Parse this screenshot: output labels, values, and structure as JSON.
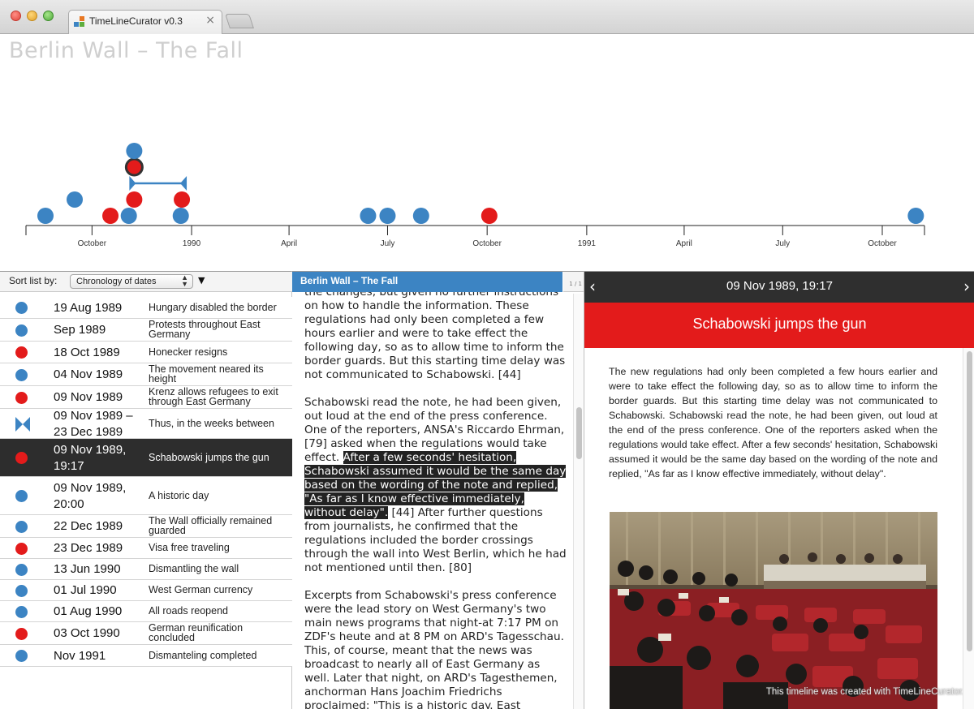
{
  "window": {
    "tab_title": "TimeLineCurator v0.3",
    "tab_close": "×"
  },
  "timeline": {
    "title": "Berlin Wall – The Fall",
    "axis_labels": [
      "October",
      "1990",
      "April",
      "July",
      "October",
      "1991",
      "April",
      "July",
      "October"
    ],
    "events": [
      {
        "date": "1989-08-19",
        "color": "blue",
        "stack": 0
      },
      {
        "date": "1989-09-15",
        "color": "blue",
        "stack": 1
      },
      {
        "date": "1989-10-18",
        "color": "red",
        "stack": 0
      },
      {
        "date": "1989-11-04",
        "color": "blue",
        "stack": 0
      },
      {
        "date": "1989-11-09",
        "color": "red",
        "stack": 1
      },
      {
        "date": "1989-11-09",
        "color": "red",
        "stack": 3,
        "selected": true
      },
      {
        "date": "1989-11-09",
        "color": "blue",
        "stack": 4
      },
      {
        "date": "1989-12-22",
        "color": "blue",
        "stack": 0
      },
      {
        "date": "1989-12-23",
        "color": "red",
        "stack": 1
      },
      {
        "date": "1990-06-13",
        "color": "blue",
        "stack": 0
      },
      {
        "date": "1990-07-01",
        "color": "blue",
        "stack": 0
      },
      {
        "date": "1990-08-01",
        "color": "blue",
        "stack": 0
      },
      {
        "date": "1990-10-03",
        "color": "red",
        "stack": 0
      },
      {
        "date": "1991-11-01",
        "color": "blue",
        "stack": 0
      }
    ],
    "range_event": {
      "start": "1989-11-09",
      "end": "1989-12-23",
      "stack": 2
    }
  },
  "sort": {
    "label": "Sort list by:",
    "value": "Chronology of dates",
    "direction": "▼"
  },
  "list": [
    {
      "date": "19 Aug 1989",
      "label": "Hungary disabled the border",
      "color": "#3c84c3",
      "kind": "dot"
    },
    {
      "date": "Sep 1989",
      "label": "Protests throughout East Germany",
      "color": "#3c84c3",
      "kind": "dot"
    },
    {
      "date": "18 Oct 1989",
      "label": "Honecker resigns",
      "color": "#e31b1b",
      "kind": "dot"
    },
    {
      "date": "04 Nov 1989",
      "label": "The movement neared its height",
      "color": "#3c84c3",
      "kind": "dot"
    },
    {
      "date": "09 Nov 1989",
      "label": "Krenz allows refugees to exit through East Germany",
      "color": "#e31b1b",
      "kind": "dot"
    },
    {
      "date": "09 Nov 1989 –\n23 Dec 1989",
      "label": "Thus, in the weeks between",
      "color": "#3c84c3",
      "kind": "range"
    },
    {
      "date": "09 Nov 1989,\n19:17",
      "label": "Schabowski jumps the gun",
      "color": "#e31b1b",
      "kind": "dot",
      "selected": true
    },
    {
      "date": "09 Nov 1989,\n20:00",
      "label": "A historic day",
      "color": "#3c84c3",
      "kind": "dot"
    },
    {
      "date": "22 Dec 1989",
      "label": "The Wall officially remained guarded",
      "color": "#3c84c3",
      "kind": "dot"
    },
    {
      "date": "23 Dec 1989",
      "label": "Visa free traveling",
      "color": "#e31b1b",
      "kind": "dot"
    },
    {
      "date": "13 Jun 1990",
      "label": "Dismantling the wall",
      "color": "#3c84c3",
      "kind": "dot"
    },
    {
      "date": "01 Jul 1990",
      "label": "West German currency",
      "color": "#3c84c3",
      "kind": "dot"
    },
    {
      "date": "01 Aug 1990",
      "label": "All roads reopend",
      "color": "#3c84c3",
      "kind": "dot"
    },
    {
      "date": "03 Oct 1990",
      "label": "German reunification concluded",
      "color": "#e31b1b",
      "kind": "dot"
    },
    {
      "date": "Nov 1991",
      "label": "Dismanteling completed",
      "color": "#3c84c3",
      "kind": "dot"
    }
  ],
  "document": {
    "header": "Berlin Wall – The Fall",
    "pager": "1 / 1",
    "p1": "the changes, but given no further instructions on how to handle the information. These regulations had only been completed a few hours earlier and were to take effect the following day, so as to allow time to inform the border guards. But this starting time delay was not communicated to Schabowski. [44]",
    "p2_before": "Schabowski read the note, he had been given, out loud at the end of the press conference. One of the reporters, ANSA's Riccardo Ehrman, [79] asked when the regulations would take effect. ",
    "p2_highlight": "After a few seconds' hesitation, Schabowski assumed it would be the same day based on the wording of the note and replied, \"As far as I know effective immediately, without delay\".",
    "p2_after": " [44] After further questions from journalists, he confirmed that the regulations included the border crossings through the wall into West Berlin, which he had not mentioned until then. [80]",
    "p3": "Excerpts from Schabowski's press conference were the lead story on West Germany's two main news programs that night-at 7:17 PM on ZDF's heute and at 8 PM on ARD's Tagesschau. This, of course, meant that the news was broadcast to nearly all of East Germany as well. Later that night, on ARD's Tagesthemen, anchorman Hans Joachim Friedrichs proclaimed: \"This is a historic day. East"
  },
  "detail": {
    "date": "09 Nov 1989, 19:17",
    "prev": "‹",
    "next": "›",
    "title": "Schabowski jumps the gun",
    "body": "The new regulations had only been completed a few hours earlier and were to take effect the following day, so as to allow time to inform the border guards. But this starting time delay was not communicated to Schabowski. Schabowski read the note, he had been given, out loud at the end of the press conference. One of the reporters asked when the regulations would take effect. After a few seconds' hesitation, Schabowski assumed it would be the same day based on the wording of the note and replied, \"As far as I know effective immediately, without delay\".",
    "credit": "This timeline was created with TimeLineCurator."
  },
  "colors": {
    "blue": "#3c84c3",
    "red": "#e31b1b",
    "header_dark": "#2f2f2f"
  }
}
